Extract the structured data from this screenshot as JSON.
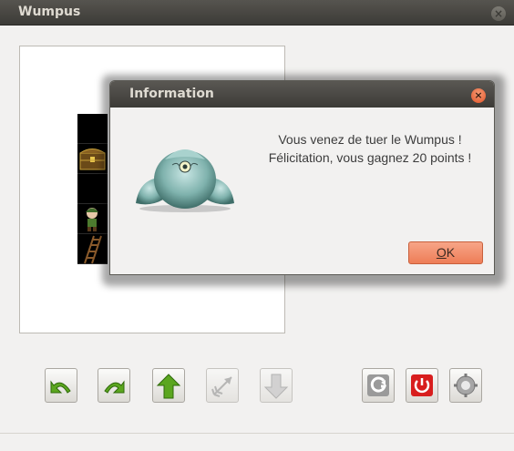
{
  "window": {
    "title": "Wumpus",
    "close_label": "×"
  },
  "board": {
    "cells": [
      {
        "content": "empty",
        "icon": "dark-cell"
      },
      {
        "content": "treasure",
        "icon": "treasure-chest-icon"
      },
      {
        "content": "empty",
        "icon": "dark-cell"
      },
      {
        "content": "player",
        "icon": "explorer-icon"
      },
      {
        "content": "ladder",
        "icon": "ladder-icon"
      }
    ]
  },
  "toolbar": {
    "buttons": [
      {
        "name": "turn-left-button",
        "icon": "turn-left-arrow-icon",
        "enabled": true
      },
      {
        "name": "turn-right-button",
        "icon": "turn-right-arrow-icon",
        "enabled": true
      },
      {
        "name": "move-forward-button",
        "icon": "up-arrow-icon",
        "enabled": true
      },
      {
        "name": "shoot-arrow-button",
        "icon": "arrow-icon",
        "enabled": false
      },
      {
        "name": "climb-down-button",
        "icon": "down-arrow-icon",
        "enabled": false
      },
      {
        "name": "restart-button",
        "icon": "restart-icon",
        "enabled": true
      },
      {
        "name": "quit-button",
        "icon": "power-icon",
        "enabled": true
      },
      {
        "name": "settings-button",
        "icon": "gear-icon",
        "enabled": true
      }
    ]
  },
  "dialog": {
    "title": "Information",
    "close_label": "×",
    "line1": "Vous venez de tuer le Wumpus !",
    "line2": "Félicitation, vous gagnez 20 points !",
    "ok_mnemonic": "O",
    "ok_rest": "K",
    "image_icon": "wumpus-monster-icon"
  },
  "colors": {
    "accent": "#ee7d57",
    "title_bar": "#3c3b37",
    "green_button": "#5ba61f"
  }
}
